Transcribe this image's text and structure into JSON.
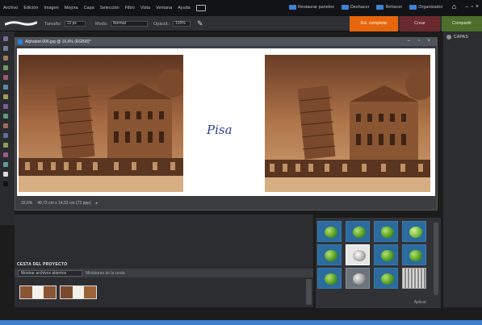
{
  "menubar": {
    "items": [
      "Archivo",
      "Edición",
      "Imagen",
      "Mejora",
      "Capa",
      "Selección",
      "Filtro",
      "Vista",
      "Ventana",
      "Ayuda"
    ],
    "right": {
      "restore": "Restaurar paneles",
      "undo": "Deshacer",
      "redo": "Rehacer",
      "organizer": "Organizador"
    }
  },
  "options": {
    "size_label": "Tamaño:",
    "size_value": "13 px",
    "mode_label": "Modo:",
    "mode_value": "Normal",
    "opacity_label": "Opacid.:",
    "opacity_value": "100%"
  },
  "modes": {
    "full": "Ed. completa",
    "create": "Crear",
    "share": "Compartir"
  },
  "document": {
    "title": "Alphabet-006.jpg @ 16,6% (RGB/8)*"
  },
  "status": {
    "zoom": "16,6%",
    "size": "48,72 cm x 14,52 cm (72 ppp)"
  },
  "canvas": {
    "caption": "Pisa"
  },
  "panel": {
    "layers": "CAPAS"
  },
  "project": {
    "header": "CESTA DEL PROYECTO",
    "select": "Mostrar archivos abiertos",
    "label": "Miniaturas de la cesta"
  },
  "effects": {
    "footer": "Aplicar"
  },
  "colors": {
    "accent_full": "#e8660b",
    "accent_create": "#6a2a2e",
    "accent_share": "#4d6f2b",
    "ink": "#2c3f8a"
  }
}
